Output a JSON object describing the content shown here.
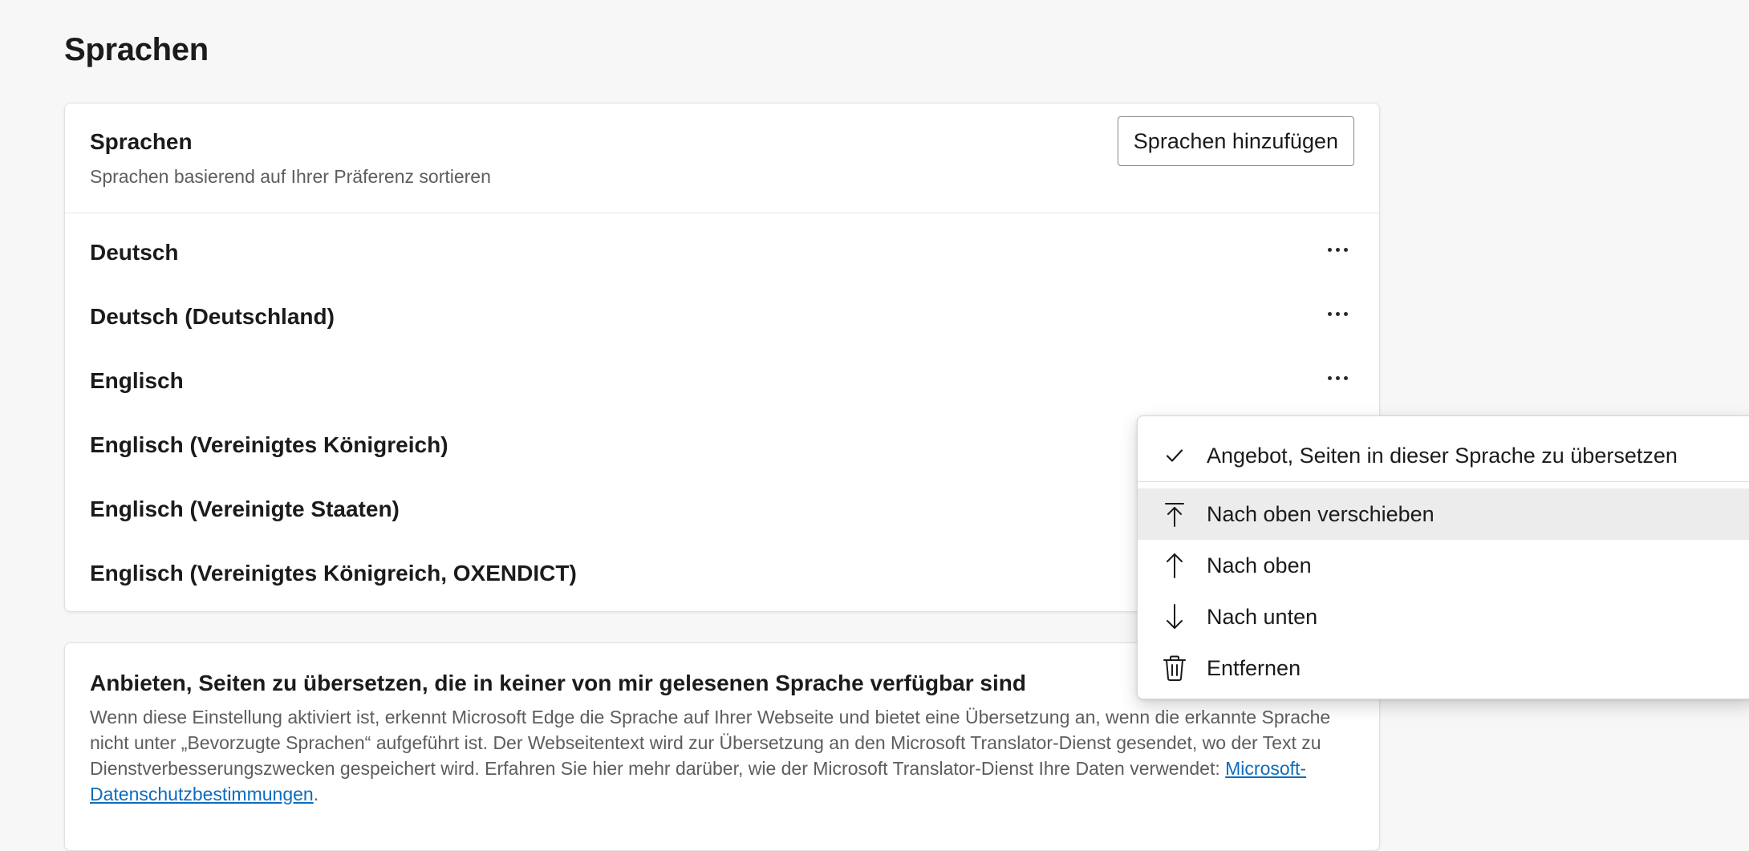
{
  "page": {
    "title": "Sprachen"
  },
  "languages_card": {
    "title": "Sprachen",
    "subtitle": "Sprachen basierend auf Ihrer Präferenz sortieren",
    "add_button_label": "Sprachen hinzufügen",
    "items": [
      {
        "label": "Deutsch",
        "has_more_button": true
      },
      {
        "label": "Deutsch (Deutschland)",
        "has_more_button": true
      },
      {
        "label": "Englisch",
        "has_more_button": true
      },
      {
        "label": "Englisch (Vereinigtes Königreich)",
        "has_more_button": false
      },
      {
        "label": "Englisch (Vereinigte Staaten)",
        "has_more_button": false
      },
      {
        "label": "Englisch (Vereinigtes Königreich, OXENDICT)",
        "has_more_button": false
      }
    ],
    "more_icon": "more-horizontal-icon"
  },
  "translate_card": {
    "title": "Anbieten, Seiten zu übersetzen, die in keiner von mir gelesenen Sprache verfügbar sind",
    "description": "Wenn diese Einstellung aktiviert ist, erkennt Microsoft Edge die Sprache auf Ihrer Webseite und bietet eine Übersetzung an, wenn die erkannte Sprache nicht unter „Bevorzugte Sprachen“ aufgeführt ist. Der Webseitentext wird zur Übersetzung an den Microsoft Translator-Dienst gesendet, wo der Text zu Dienstverbesserungszwecken gespeichert wird. Erfahren Sie hier mehr darüber, wie der Microsoft Translator-Dienst Ihre Daten verwendet: ",
    "link_label": "Microsoft-Datenschutzbestimmungen",
    "trailing": "."
  },
  "context_menu": {
    "items": [
      {
        "label": "Angebot, Seiten in dieser Sprache zu übersetzen",
        "icon": "checkmark-icon",
        "checked": true
      },
      {
        "label": "Nach oben verschieben",
        "icon": "move-to-top-icon",
        "highlighted": true
      },
      {
        "label": "Nach oben",
        "icon": "arrow-up-icon"
      },
      {
        "label": "Nach unten",
        "icon": "arrow-down-icon"
      },
      {
        "label": "Entfernen",
        "icon": "trash-icon"
      }
    ]
  },
  "colors": {
    "background": "#f7f7f7",
    "card": "#ffffff",
    "link": "#0f6cbd",
    "menu_highlight": "#ececec"
  }
}
